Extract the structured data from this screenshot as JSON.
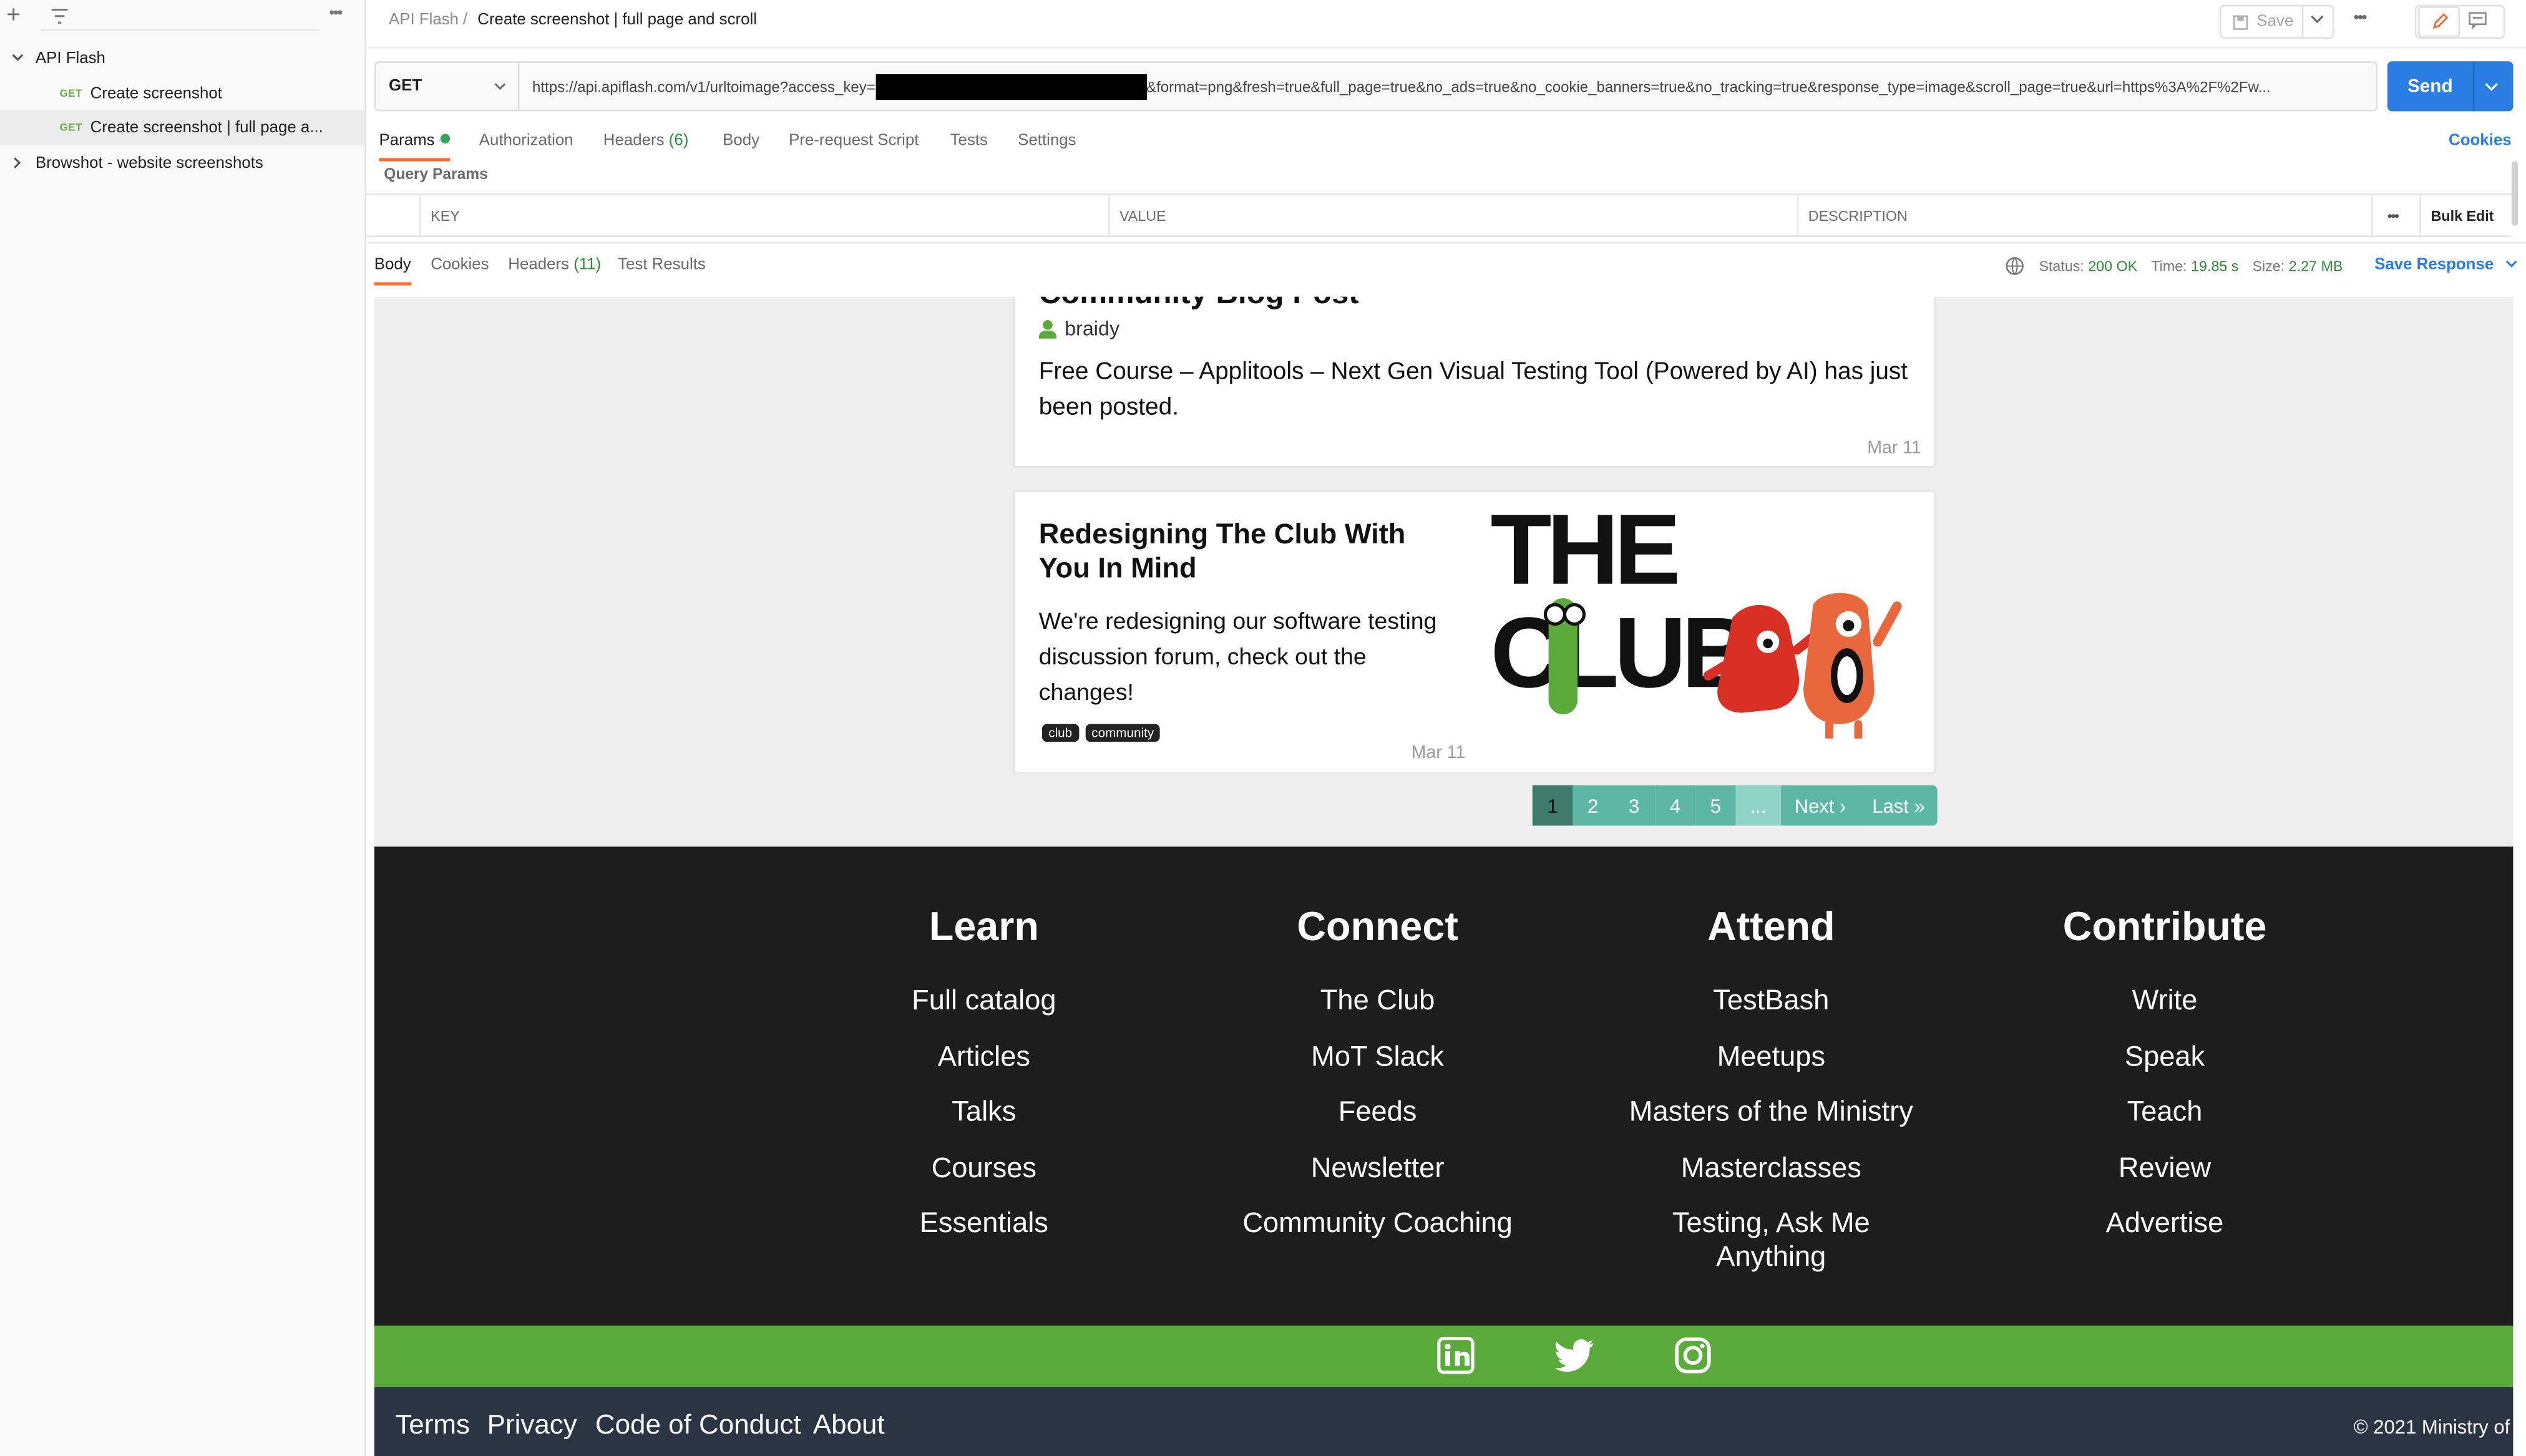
{
  "sidebar": {
    "collections": [
      {
        "name": "API Flash",
        "requests": [
          {
            "method": "GET",
            "name": "Create screenshot"
          },
          {
            "method": "GET",
            "name": "Create screenshot | full page a..."
          }
        ]
      },
      {
        "name": "Browshot - website screenshots"
      }
    ]
  },
  "header": {
    "breadcrumb_parent": "API Flash",
    "breadcrumb_sep": "/",
    "title": "Create screenshot | full page and scroll",
    "save_label": "Save"
  },
  "request": {
    "method": "GET",
    "url_prefix": "https://api.apiflash.com/v1/urltoimage?access_key=",
    "url_suffix": "&format=png&fresh=true&full_page=true&no_ads=true&no_cookie_banners=true&no_tracking=true&response_type=image&scroll_page=true&url=https%3A%2F%2Fw...",
    "send_label": "Send"
  },
  "request_tabs": [
    {
      "label": "Params"
    },
    {
      "label": "Authorization"
    },
    {
      "label": "Headers",
      "count": "(6)"
    },
    {
      "label": "Body"
    },
    {
      "label": "Pre-request Script"
    },
    {
      "label": "Tests"
    },
    {
      "label": "Settings"
    }
  ],
  "cookies_link": "Cookies",
  "query_params_label": "Query Params",
  "params_table": {
    "key": "KEY",
    "value": "VALUE",
    "description": "DESCRIPTION",
    "bulk_edit": "Bulk Edit"
  },
  "response_tabs": [
    {
      "label": "Body"
    },
    {
      "label": "Cookies"
    },
    {
      "label": "Headers",
      "count": "(11)"
    },
    {
      "label": "Test Results"
    }
  ],
  "response_meta": {
    "status_label": "Status:",
    "status_value": "200 OK",
    "time_label": "Time:",
    "time_value": "19.85 s",
    "size_label": "Size:",
    "size_value": "2.27 MB",
    "save_response": "Save Response"
  },
  "site": {
    "post1": {
      "title_partial": "Community Blog Post",
      "author": "braidy",
      "text": "Free Course – Applitools – Next Gen Visual Testing Tool (Powered by AI) has just been posted.",
      "date": "Mar 11"
    },
    "post2": {
      "title": "Redesigning The Club With You In Mind",
      "text": "We're redesigning our software testing discussion forum, check out the changes!",
      "tags": [
        "club",
        "community"
      ],
      "date": "Mar 11",
      "logo_line1": "THE",
      "logo_line2": "CLUB"
    },
    "pagination": [
      "1",
      "2",
      "3",
      "4",
      "5",
      "...",
      "Next ›",
      "Last »"
    ],
    "footer": {
      "columns": [
        {
          "heading": "Learn",
          "links": [
            "Full catalog",
            "Articles",
            "Talks",
            "Courses",
            "Essentials"
          ]
        },
        {
          "heading": "Connect",
          "links": [
            "The Club",
            "MoT Slack",
            "Feeds",
            "Newsletter",
            "Community Coaching"
          ]
        },
        {
          "heading": "Attend",
          "links": [
            "TestBash",
            "Meetups",
            "Masters of the Ministry",
            "Masterclasses",
            "Testing, Ask Me Anything"
          ]
        },
        {
          "heading": "Contribute",
          "links": [
            "Write",
            "Speak",
            "Teach",
            "Review",
            "Advertise"
          ]
        }
      ],
      "social": [
        "linkedin-icon",
        "twitter-icon",
        "instagram-icon"
      ],
      "bottom_links": [
        "Terms",
        "Privacy",
        "Code of Conduct",
        "About"
      ],
      "copyright": "© 2021 Ministry of"
    }
  },
  "colors": {
    "accent_blue": "#2a7de1",
    "status_green": "#2f8a3b",
    "footer_dark": "#1d1d1d",
    "social_bar_green": "#5aaa3c",
    "bottom_bar": "#2b3442",
    "pagination_teal": "#5cb8a5",
    "pagination_active": "#3d7a6c"
  }
}
